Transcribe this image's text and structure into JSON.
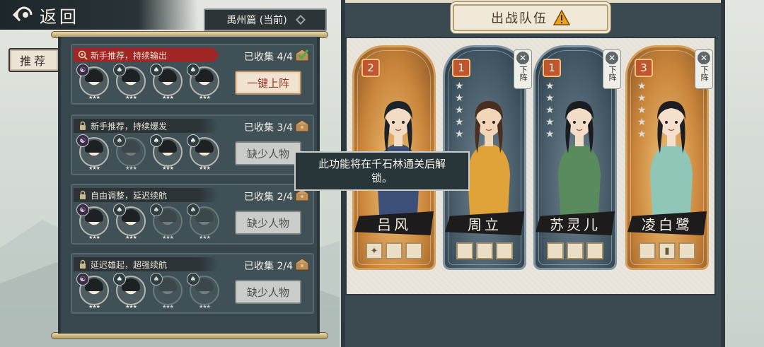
{
  "nav": {
    "back_label": "返回"
  },
  "chapter": {
    "label": "禹州篇 (当前)"
  },
  "tabs": {
    "recommend": "推荐"
  },
  "lineups": [
    {
      "title": "新手推荐，持续输出",
      "collected": "已收集 4/4",
      "button": "一键上阵",
      "active": true,
      "avatars": [
        {
          "type": "yy",
          "badge": "☯"
        },
        {
          "type": "leaf",
          "badge": "♠"
        },
        {
          "type": "leaf",
          "badge": "♠"
        },
        {
          "type": "leaf",
          "badge": "♠"
        }
      ]
    },
    {
      "title": "新手推荐，持续爆发",
      "collected": "已收集 3/4",
      "button": "缺少人物",
      "active": false,
      "avatars": [
        {
          "type": "yy",
          "badge": "☯"
        },
        {
          "type": "leaf",
          "badge": "♠",
          "dim": true
        },
        {
          "type": "leaf",
          "badge": "♠"
        },
        {
          "type": "leaf",
          "badge": "♠"
        }
      ]
    },
    {
      "title": "自由调整，延迟续航",
      "collected": "已收集 2/4",
      "button": "缺少人物",
      "active": false,
      "avatars": [
        {
          "type": "yy",
          "badge": "☯"
        },
        {
          "type": "leaf",
          "badge": "♠"
        },
        {
          "type": "leaf",
          "badge": "♠",
          "dim": true
        },
        {
          "type": "leaf",
          "badge": "♠",
          "dim": true
        }
      ]
    },
    {
      "title": "延迟雄起，超强续航",
      "collected": "已收集 2/4",
      "button": "缺少人物",
      "active": false,
      "avatars": [
        {
          "type": "yy",
          "badge": "☯"
        },
        {
          "type": "leaf",
          "badge": "♠"
        },
        {
          "type": "leaf",
          "badge": "♠",
          "dim": true
        },
        {
          "type": "leaf",
          "badge": "♠",
          "dim": true
        }
      ]
    }
  ],
  "team": {
    "title": "出战队伍",
    "remove_label": "下阵",
    "heroes": [
      {
        "name": "吕风",
        "cost": "2",
        "style": "gold",
        "removable": false,
        "stars": 0,
        "equips": [
          "✦",
          "",
          ""
        ]
      },
      {
        "name": "周立",
        "cost": "1",
        "style": "blue",
        "removable": true,
        "stars": 5,
        "equips": [
          "",
          "",
          ""
        ]
      },
      {
        "name": "苏灵儿",
        "cost": "1",
        "style": "blue",
        "removable": true,
        "stars": 5,
        "equips": [
          "",
          "",
          ""
        ]
      },
      {
        "name": "凌白鹭",
        "cost": "3",
        "style": "gold",
        "removable": true,
        "stars": 5,
        "equips": [
          "",
          "▮",
          ""
        ]
      }
    ]
  },
  "tooltip": {
    "text": "此功能将在千石林通关后解锁。"
  }
}
